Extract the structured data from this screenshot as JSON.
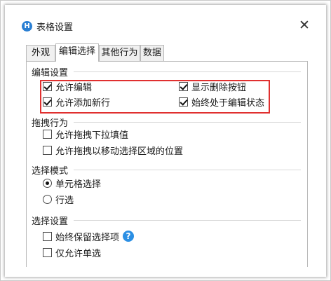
{
  "dialog": {
    "icon_glyph": "H",
    "icon_name": "app-icon",
    "title": "表格设置",
    "close_glyph": "✕"
  },
  "tabs": [
    {
      "label": "外观",
      "active": false
    },
    {
      "label": "编辑选择",
      "active": true
    },
    {
      "label": "其他行为",
      "active": false
    },
    {
      "label": "数据",
      "active": false
    }
  ],
  "sections": {
    "edit": {
      "title": "编辑设置",
      "options": [
        {
          "label": "允许编辑",
          "checked": true
        },
        {
          "label": "显示删除按钮",
          "checked": true
        },
        {
          "label": "允许添加新行",
          "checked": true
        },
        {
          "label": "始终处于编辑状态",
          "checked": true
        }
      ]
    },
    "drag": {
      "title": "拖拽行为",
      "options": [
        {
          "label": "允许拖拽下拉填值",
          "checked": false
        },
        {
          "label": "允许拖拽以移动选择区域的位置",
          "checked": false
        }
      ]
    },
    "selection_mode": {
      "title": "选择模式",
      "options": [
        {
          "label": "单元格选择",
          "selected": true
        },
        {
          "label": "行选",
          "selected": false
        }
      ]
    },
    "selection_settings": {
      "title": "选择设置",
      "options": [
        {
          "label": "始终保留选择项",
          "checked": false
        },
        {
          "label": "仅允许单选",
          "checked": false
        }
      ],
      "help_glyph": "?"
    }
  },
  "colors": {
    "highlight_border": "#e0302f",
    "help_icon": "#2b8fe4",
    "app_icon": "#2a7fd3"
  }
}
